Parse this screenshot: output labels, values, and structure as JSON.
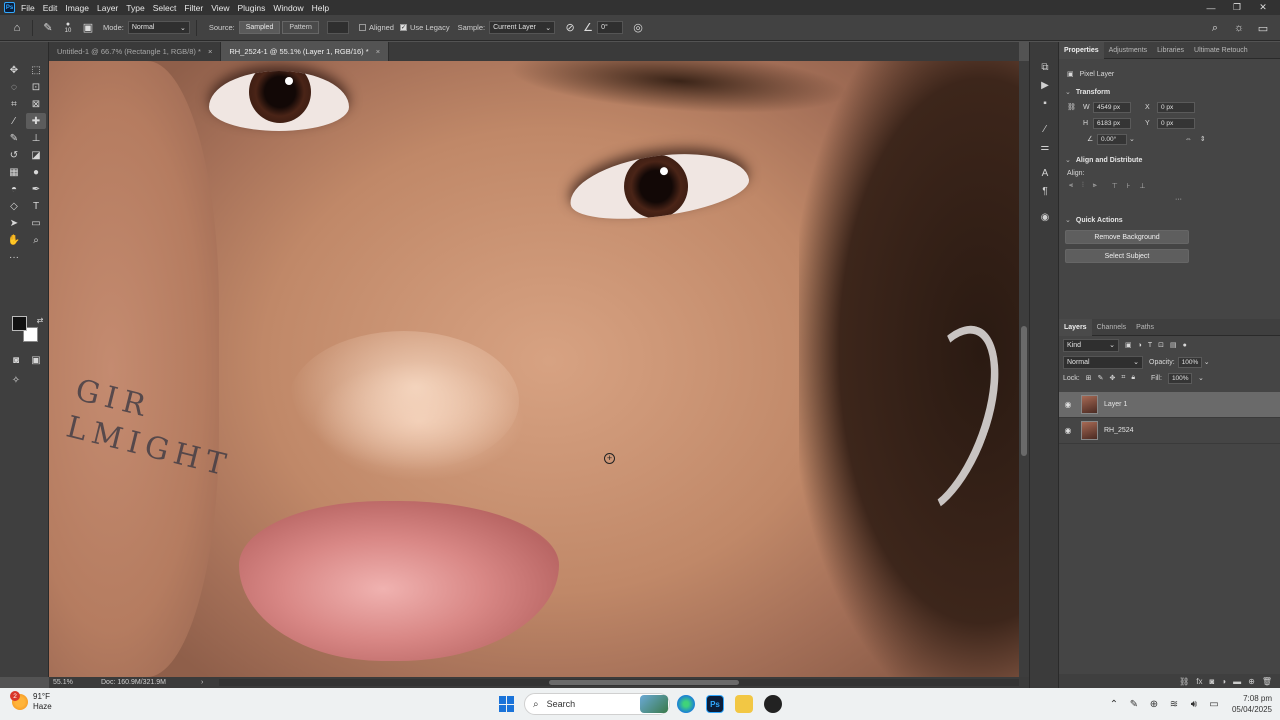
{
  "app": {
    "logo": "Ps",
    "menus": [
      "File",
      "Edit",
      "Image",
      "Layer",
      "Type",
      "Select",
      "Filter",
      "View",
      "Plugins",
      "Window",
      "Help"
    ],
    "window_controls": [
      "—",
      "❐",
      "✕"
    ]
  },
  "options_bar": {
    "brush_size": "10",
    "mode_label": "Mode:",
    "mode_value": "Normal",
    "source_label": "Source:",
    "source_sampled": "Sampled",
    "source_pattern": "Pattern",
    "aligned_label": "Aligned",
    "use_legacy_label": "Use Legacy",
    "sample_label": "Sample:",
    "sample_value": "Current Layer",
    "angle_value": "0°"
  },
  "tabs": [
    {
      "label": "Untitled-1 @ 66.7% (Rectangle 1, RGB/8) *",
      "active": false
    },
    {
      "label": "RH_2524-1 @ 55.1% (Layer 1, RGB/16) *",
      "active": true
    }
  ],
  "tab_close": "×",
  "canvas": {
    "tattoo_line1": "GIR",
    "tattoo_line2": "LMIGHT"
  },
  "status": {
    "zoom": "55.1%",
    "doc": "Doc: 160.9M/321.9M"
  },
  "properties": {
    "tabs": [
      "Properties",
      "Adjustments",
      "Libraries",
      "Ultimate Retouch"
    ],
    "layer_type": "Pixel Layer",
    "transform_title": "Transform",
    "w_label": "W",
    "w_value": "4549 px",
    "h_label": "H",
    "h_value": "6183 px",
    "x_label": "X",
    "x_value": "0 px",
    "y_label": "Y",
    "y_value": "0 px",
    "angle_value": "0.00°",
    "align_title": "Align and Distribute",
    "align_label": "Align:",
    "quick_actions_title": "Quick Actions",
    "remove_background": "Remove Background",
    "select_subject": "Select Subject"
  },
  "layers_panel": {
    "tabs": [
      "Layers",
      "Channels",
      "Paths"
    ],
    "kind_label": "Kind",
    "blend_mode": "Normal",
    "opacity_label": "Opacity:",
    "opacity_value": "100%",
    "lock_label": "Lock:",
    "fill_label": "Fill:",
    "fill_value": "100%",
    "layers": [
      {
        "name": "Layer 1",
        "selected": true
      },
      {
        "name": "RH_2524",
        "selected": false
      }
    ]
  },
  "taskbar": {
    "weather_badge": "2",
    "temperature": "91°F",
    "condition": "Haze",
    "search_placeholder": "Search",
    "time": "7:08 pm",
    "date": "05/04/2025"
  },
  "colors": {
    "accent": "#31a8ff",
    "foreground_swatch": "#111111",
    "background_swatch": "#ffffff"
  }
}
